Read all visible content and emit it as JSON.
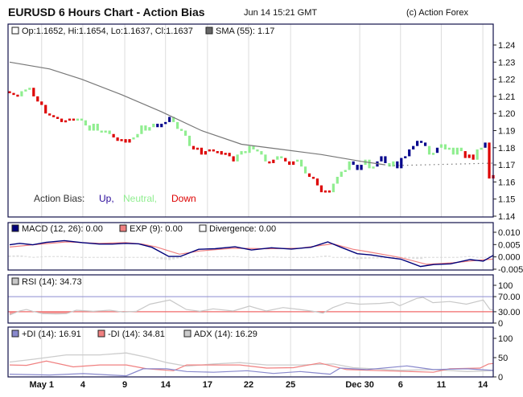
{
  "header": {
    "title": "EURUSD 6 Hours Chart - Action Bias",
    "timestamp": "Jun 14 15:21 GMT",
    "copyright": "(c) Action Forex"
  },
  "colors": {
    "up": "#00008b",
    "neutral": "#90ee90",
    "down": "#dd0000",
    "sma": "#777777",
    "macd": "#00007a",
    "exp": "#f08080",
    "divergence": "#dddddd",
    "rsi": "#c8c8c8",
    "rsi_70": "#8c8cd0",
    "rsi_30": "#f06a6a",
    "plus_di": "#8888cc",
    "minus_di": "#f08080",
    "adx": "#cccccc",
    "frame": "#10104a",
    "grid": "#dcdcdc"
  },
  "chart_data": [
    {
      "type": "candlestick",
      "legend": {
        "ohlc": "Op:1.1652, Hi:1.1654, Lo:1.1637, Cl:1.1637",
        "sma": "SMA (55): 1.17"
      },
      "bias_legend": {
        "label": "Action Bias:",
        "up": "Up,",
        "neutral": "Neutral,",
        "down": "Down"
      },
      "ylim": [
        1.14,
        1.24
      ],
      "yticks": [
        "1.14",
        "1.15",
        "1.16",
        "1.17",
        "1.18",
        "1.19",
        "1.20",
        "1.21",
        "1.22",
        "1.23",
        "1.24"
      ],
      "first_open": 1.213,
      "closes": [
        1.212,
        1.211,
        1.21,
        1.213,
        1.214,
        1.215,
        1.21,
        1.207,
        1.205,
        1.2,
        1.199,
        1.198,
        1.197,
        1.195,
        1.196,
        1.197,
        1.196,
        1.197,
        1.196,
        1.193,
        1.19,
        1.194,
        1.19,
        1.189,
        1.19,
        1.188,
        1.186,
        1.184,
        1.185,
        1.183,
        1.185,
        1.186,
        1.188,
        1.193,
        1.19,
        1.192,
        1.194,
        1.192,
        1.194,
        1.195,
        1.198,
        1.195,
        1.191,
        1.19,
        1.187,
        1.181,
        1.179,
        1.18,
        1.176,
        1.178,
        1.179,
        1.178,
        1.178,
        1.176,
        1.177,
        1.175,
        1.172,
        1.176,
        1.178,
        1.177,
        1.181,
        1.179,
        1.178,
        1.176,
        1.172,
        1.171,
        1.173,
        1.175,
        1.174,
        1.172,
        1.17,
        1.172,
        1.173,
        1.169,
        1.165,
        1.163,
        1.162,
        1.158,
        1.154,
        1.155,
        1.154,
        1.159,
        1.163,
        1.166,
        1.167,
        1.172,
        1.17,
        1.167,
        1.17,
        1.173,
        1.168,
        1.169,
        1.172,
        1.175,
        1.171,
        1.169,
        1.172,
        1.168,
        1.174,
        1.175,
        1.179,
        1.181,
        1.184,
        1.183,
        1.181,
        1.176,
        1.177,
        1.18,
        1.182,
        1.179,
        1.18,
        1.176,
        1.18,
        1.178,
        1.174,
        1.176,
        1.173,
        1.179,
        1.18,
        1.183,
        1.162,
        1.164
      ],
      "bias": "DDDNNNDDDDDDDDDDDNNNNNNNNNDDDDDNNNNNNUUUUNNNNNDDDDDDDDDDDNNNNNNNNDDNNDDDNNNDDDDDDNNNNNUUUNNNUUUNNUUUUUUUUNNUNNNNNNDDDNNUDD",
      "sma_line": [
        [
          0,
          1.23
        ],
        [
          10,
          1.226
        ],
        [
          18,
          1.22
        ],
        [
          28,
          1.211
        ],
        [
          38,
          1.201
        ],
        [
          48,
          1.19
        ],
        [
          58,
          1.182
        ],
        [
          68,
          1.179
        ],
        [
          78,
          1.176
        ],
        [
          88,
          1.172
        ],
        [
          94,
          1.17
        ]
      ],
      "sma_projection": [
        [
          95,
          1.1695
        ],
        [
          121,
          1.171
        ]
      ],
      "xticks": [
        {
          "label": "May 1",
          "at": 8
        },
        {
          "label": "4",
          "at": 18.3
        },
        {
          "label": "9",
          "at": 28.8
        },
        {
          "label": "14",
          "at": 39
        },
        {
          "label": "17",
          "at": 49.5
        },
        {
          "label": "22",
          "at": 59.8
        },
        {
          "label": "25",
          "at": 70.3
        },
        {
          "label": "Dec 30",
          "at": 87.6
        },
        {
          "label": "6",
          "at": 97.8
        },
        {
          "label": "11",
          "at": 108
        },
        {
          "label": "14",
          "at": 118.4
        }
      ]
    },
    {
      "type": "line",
      "legend": {
        "macd": "MACD (12, 26): 0.00",
        "exp": "EXP (9): 0.00",
        "divergence": "Divergence: 0.00"
      },
      "ylim": [
        -0.005,
        0.012
      ],
      "yticks": [
        "-0.005",
        "0.000",
        "0.005",
        "0.010"
      ],
      "macd": [
        [
          0,
          0.0049
        ],
        [
          2.5,
          0.0055
        ],
        [
          5.8,
          0.0049
        ],
        [
          9.1,
          0.0059
        ],
        [
          13.7,
          0.0066
        ],
        [
          18.2,
          0.0058
        ],
        [
          22.4,
          0.0052
        ],
        [
          25.7,
          0.0052
        ],
        [
          29,
          0.0055
        ],
        [
          32.3,
          0.0053
        ],
        [
          35.6,
          0.0039
        ],
        [
          39.8,
          0.0002
        ],
        [
          42.7,
          0.0002
        ],
        [
          47.3,
          0.0031
        ],
        [
          51.4,
          0.0033
        ],
        [
          56.4,
          0.0041
        ],
        [
          60.5,
          0.0028
        ],
        [
          65.5,
          0.0037
        ],
        [
          70.5,
          0.0032
        ],
        [
          75.4,
          0.0039
        ],
        [
          79.6,
          0.0061
        ],
        [
          82.9,
          0.0039
        ],
        [
          87,
          0.0013
        ],
        [
          90.4,
          0.0008
        ],
        [
          94.5,
          -0.0002
        ],
        [
          97.8,
          -0.0009
        ],
        [
          102.8,
          -0.0039
        ],
        [
          106.1,
          -0.0031
        ],
        [
          110.3,
          -0.0028
        ],
        [
          115.2,
          -0.0011
        ],
        [
          118.5,
          -0.0017
        ],
        [
          121,
          0.0006
        ]
      ],
      "exp": [
        [
          0,
          0.004
        ],
        [
          5.8,
          0.0049
        ],
        [
          14.2,
          0.0061
        ],
        [
          22.4,
          0.0055
        ],
        [
          29,
          0.0058
        ],
        [
          33.2,
          0.0052
        ],
        [
          36.5,
          0.0041
        ],
        [
          42.5,
          0.0011
        ],
        [
          47.5,
          0.0024
        ],
        [
          55.9,
          0.0035
        ],
        [
          64.2,
          0.0033
        ],
        [
          72.6,
          0.0035
        ],
        [
          80.9,
          0.0053
        ],
        [
          85.9,
          0.0031
        ],
        [
          89.2,
          0.0022
        ],
        [
          97.6,
          -0.0002
        ],
        [
          104.3,
          -0.003
        ],
        [
          110.9,
          -0.0024
        ],
        [
          117.6,
          -0.0013
        ],
        [
          121,
          -0.0009
        ]
      ]
    },
    {
      "type": "line",
      "legend": {
        "rsi": "RSI (14): 34.73"
      },
      "ylim": [
        0,
        100
      ],
      "yticks": [
        "0",
        "30.00",
        "70.00",
        "100"
      ],
      "levels": [
        70,
        30
      ],
      "rsi": [
        [
          0,
          21.4
        ],
        [
          2.5,
          32
        ],
        [
          4.2,
          36
        ],
        [
          5.8,
          31
        ],
        [
          8.3,
          25
        ],
        [
          11.7,
          24
        ],
        [
          14.2,
          25
        ],
        [
          16.7,
          34
        ],
        [
          20.9,
          31
        ],
        [
          25,
          34
        ],
        [
          28.4,
          29
        ],
        [
          31.7,
          31
        ],
        [
          35.1,
          50
        ],
        [
          40.1,
          61
        ],
        [
          44.2,
          36
        ],
        [
          47.6,
          31
        ],
        [
          50.9,
          37.6
        ],
        [
          55.9,
          32
        ],
        [
          60,
          45
        ],
        [
          64.2,
          32
        ],
        [
          68.4,
          41
        ],
        [
          72.6,
          36
        ],
        [
          75.9,
          31
        ],
        [
          78.4,
          26.4
        ],
        [
          80.9,
          41
        ],
        [
          84.3,
          54
        ],
        [
          87.6,
          50
        ],
        [
          92.6,
          52
        ],
        [
          95.9,
          55
        ],
        [
          97.6,
          46
        ],
        [
          101.8,
          65
        ],
        [
          103.4,
          68
        ],
        [
          105.9,
          54
        ],
        [
          110.1,
          57
        ],
        [
          114.3,
          50
        ],
        [
          118.5,
          61
        ],
        [
          120.2,
          36
        ],
        [
          121,
          34.7
        ]
      ]
    },
    {
      "type": "line",
      "legend": {
        "plus_di": "+DI (14): 16.91",
        "minus_di": "-DI (14): 34.81",
        "adx": "ADX (14): 16.29"
      },
      "ylim": [
        0,
        100
      ],
      "yticks": [
        "0",
        "50",
        "100"
      ],
      "adx": [
        [
          0,
          38.6
        ],
        [
          5.8,
          45.7
        ],
        [
          14.2,
          57
        ],
        [
          22.6,
          57
        ],
        [
          29.2,
          62
        ],
        [
          34.3,
          51
        ],
        [
          39.3,
          37
        ],
        [
          44.3,
          28
        ],
        [
          51,
          33.6
        ],
        [
          57.6,
          37
        ],
        [
          64.3,
          31
        ],
        [
          72.7,
          31
        ],
        [
          81,
          33.6
        ],
        [
          86,
          24
        ],
        [
          97.7,
          17
        ],
        [
          106,
          19
        ],
        [
          114.4,
          14
        ],
        [
          121,
          16.3
        ]
      ],
      "plus_di": [
        [
          0,
          7
        ],
        [
          10,
          5
        ],
        [
          18.4,
          8.6
        ],
        [
          29.2,
          3
        ],
        [
          33.4,
          21
        ],
        [
          39.3,
          21
        ],
        [
          44.3,
          14
        ],
        [
          51,
          12
        ],
        [
          59.4,
          16
        ],
        [
          66,
          9
        ],
        [
          72.7,
          14
        ],
        [
          80.2,
          7
        ],
        [
          82.7,
          23
        ],
        [
          89.4,
          19
        ],
        [
          99.4,
          28.6
        ],
        [
          106,
          19
        ],
        [
          114.4,
          21
        ],
        [
          121,
          16.9
        ]
      ],
      "minus_di": [
        [
          0,
          31
        ],
        [
          4.2,
          30
        ],
        [
          9.2,
          41
        ],
        [
          15.9,
          26
        ],
        [
          22.6,
          31
        ],
        [
          29.2,
          31
        ],
        [
          34.3,
          21
        ],
        [
          41,
          16
        ],
        [
          44.3,
          31
        ],
        [
          51,
          31
        ],
        [
          57.6,
          31
        ],
        [
          64.3,
          23
        ],
        [
          71,
          24
        ],
        [
          77.6,
          36
        ],
        [
          84.3,
          19
        ],
        [
          93.5,
          16
        ],
        [
          106,
          12
        ],
        [
          110.1,
          21
        ],
        [
          117.7,
          23
        ],
        [
          119.8,
          33.6
        ],
        [
          121,
          34.8
        ]
      ]
    }
  ]
}
